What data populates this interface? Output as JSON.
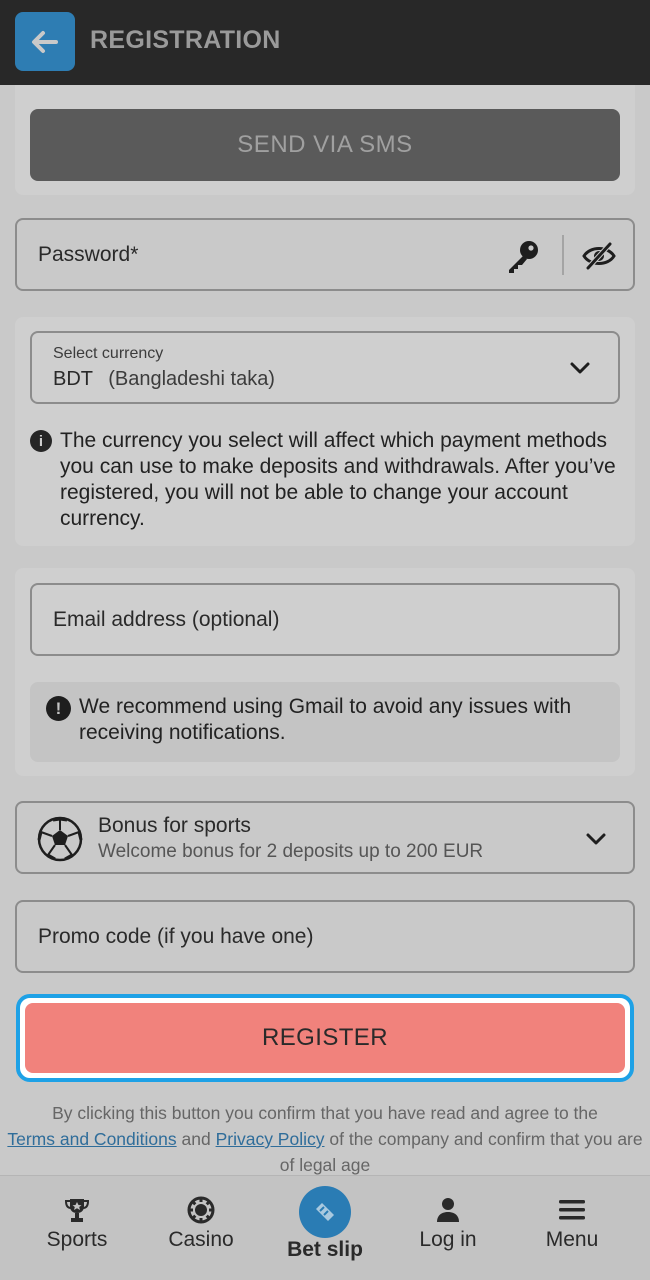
{
  "header": {
    "title": "REGISTRATION"
  },
  "sms": {
    "button_label": "SEND VIA SMS"
  },
  "password": {
    "placeholder": "Password*"
  },
  "currency": {
    "label": "Select currency",
    "code": "BDT",
    "name": "(Bangladeshi taka)",
    "info": "The currency you select will affect which payment methods you can use to make deposits and withdrawals. After you’ve registered, you will not be able to change your account currency."
  },
  "email": {
    "placeholder": "Email address (optional)",
    "note": "We recommend using Gmail to avoid any issues with receiving notifications."
  },
  "bonus": {
    "title": "Bonus for sports",
    "subtitle": "Welcome bonus for 2 deposits up to 200 EUR"
  },
  "promo": {
    "placeholder": "Promo code (if you have one)"
  },
  "register": {
    "label": "REGISTER"
  },
  "legal": {
    "prefix": "By clicking this button you confirm that you have read and agree to the",
    "terms_link": "Terms and Conditions",
    "and": "and",
    "privacy_link": "Privacy Policy",
    "suffix": "of the company and confirm that you are of legal age"
  },
  "nav": {
    "items": [
      {
        "label": "Sports",
        "icon": "trophy-icon"
      },
      {
        "label": "Casino",
        "icon": "casino-chip-icon"
      },
      {
        "label": "Bet slip",
        "icon": "ticket-icon"
      },
      {
        "label": "Log in",
        "icon": "user-icon"
      },
      {
        "label": "Menu",
        "icon": "hamburger-icon"
      }
    ]
  },
  "colors": {
    "header_bg": "#282828",
    "accent_blue": "#2e7db3",
    "register_bg": "#f1827c",
    "focus_ring": "#1ea1e6"
  }
}
